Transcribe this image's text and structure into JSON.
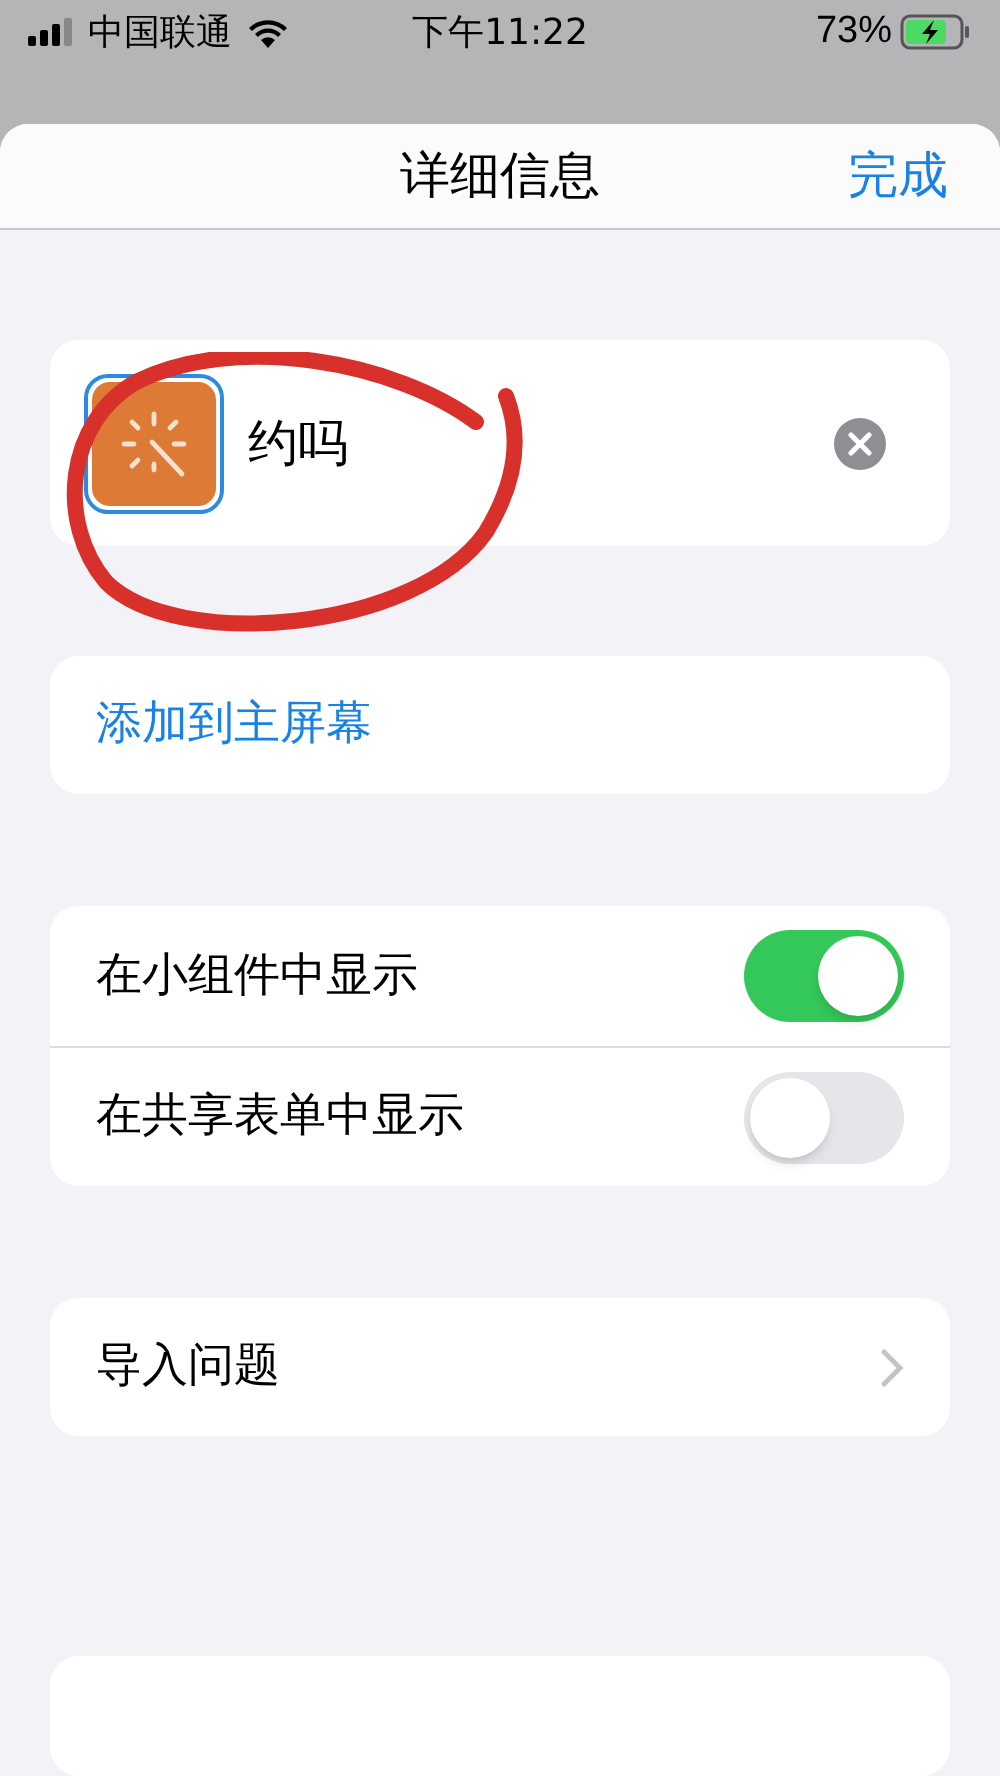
{
  "status_bar": {
    "carrier": "中国联通",
    "time": "下午11:22",
    "battery": "73%"
  },
  "header": {
    "title": "详细信息",
    "done": "完成"
  },
  "shortcut": {
    "name": "约吗"
  },
  "add_to_home": "添加到主屏幕",
  "toggles": [
    {
      "label": "在小组件中显示",
      "on": true
    },
    {
      "label": "在共享表单中显示",
      "on": false
    }
  ],
  "import_questions": "导入问题"
}
